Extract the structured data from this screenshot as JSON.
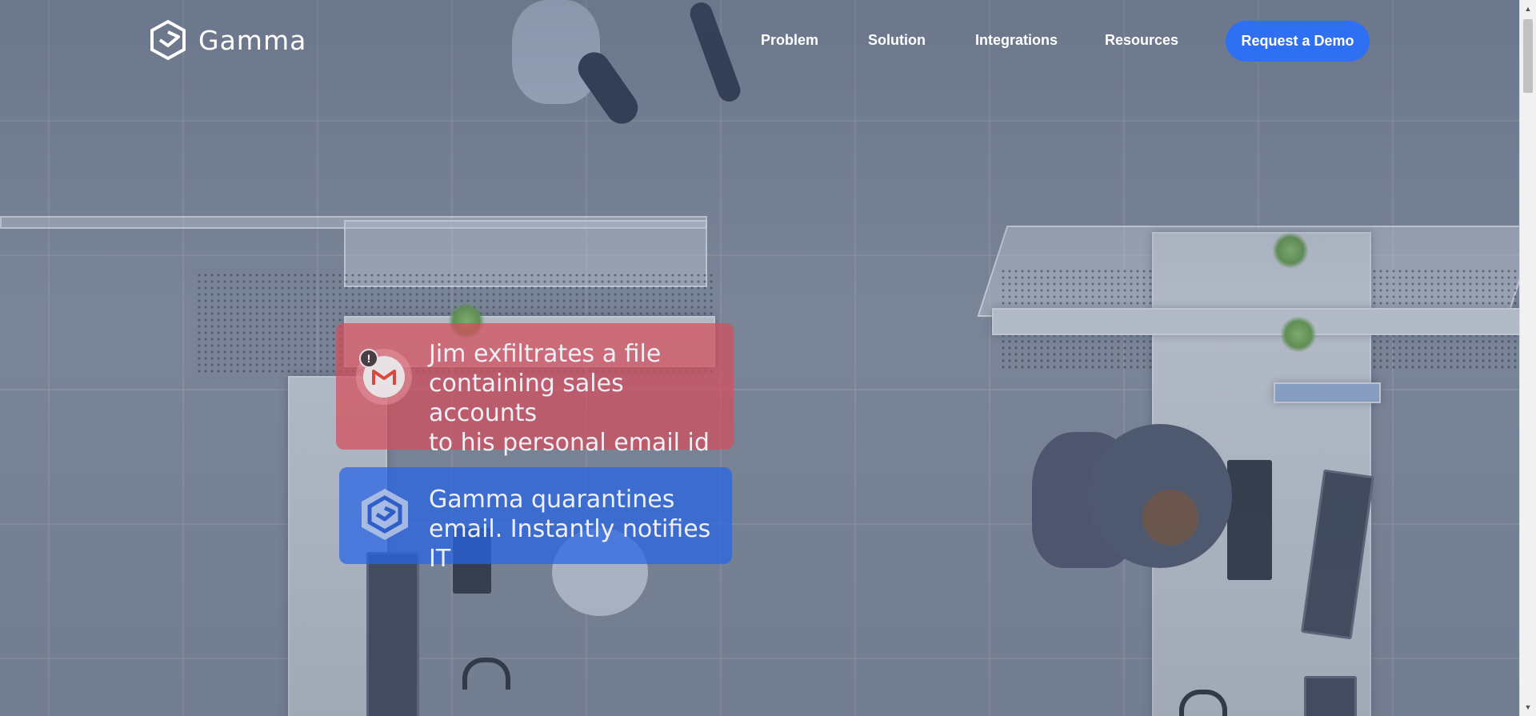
{
  "brand": {
    "name": "Gamma",
    "accent_color": "#2f6ff2"
  },
  "nav": {
    "links": [
      "Problem",
      "Solution",
      "Integrations",
      "Resources"
    ],
    "cta_label": "Request a Demo"
  },
  "cards": {
    "threat": {
      "icon": "gmail-icon",
      "badge": "!",
      "text": "Jim exfiltrates a file\ncontaining sales accounts\nto his personal email id",
      "color": "#d64e5c"
    },
    "response": {
      "icon": "gamma-shield-icon",
      "text": "Gamma quarantines\nemail. Instantly notifies IT",
      "color": "#2764e6"
    }
  },
  "scrollbar": {
    "up_icon": "scroll-up-arrow-icon",
    "down_icon": "scroll-down-arrow-icon"
  }
}
